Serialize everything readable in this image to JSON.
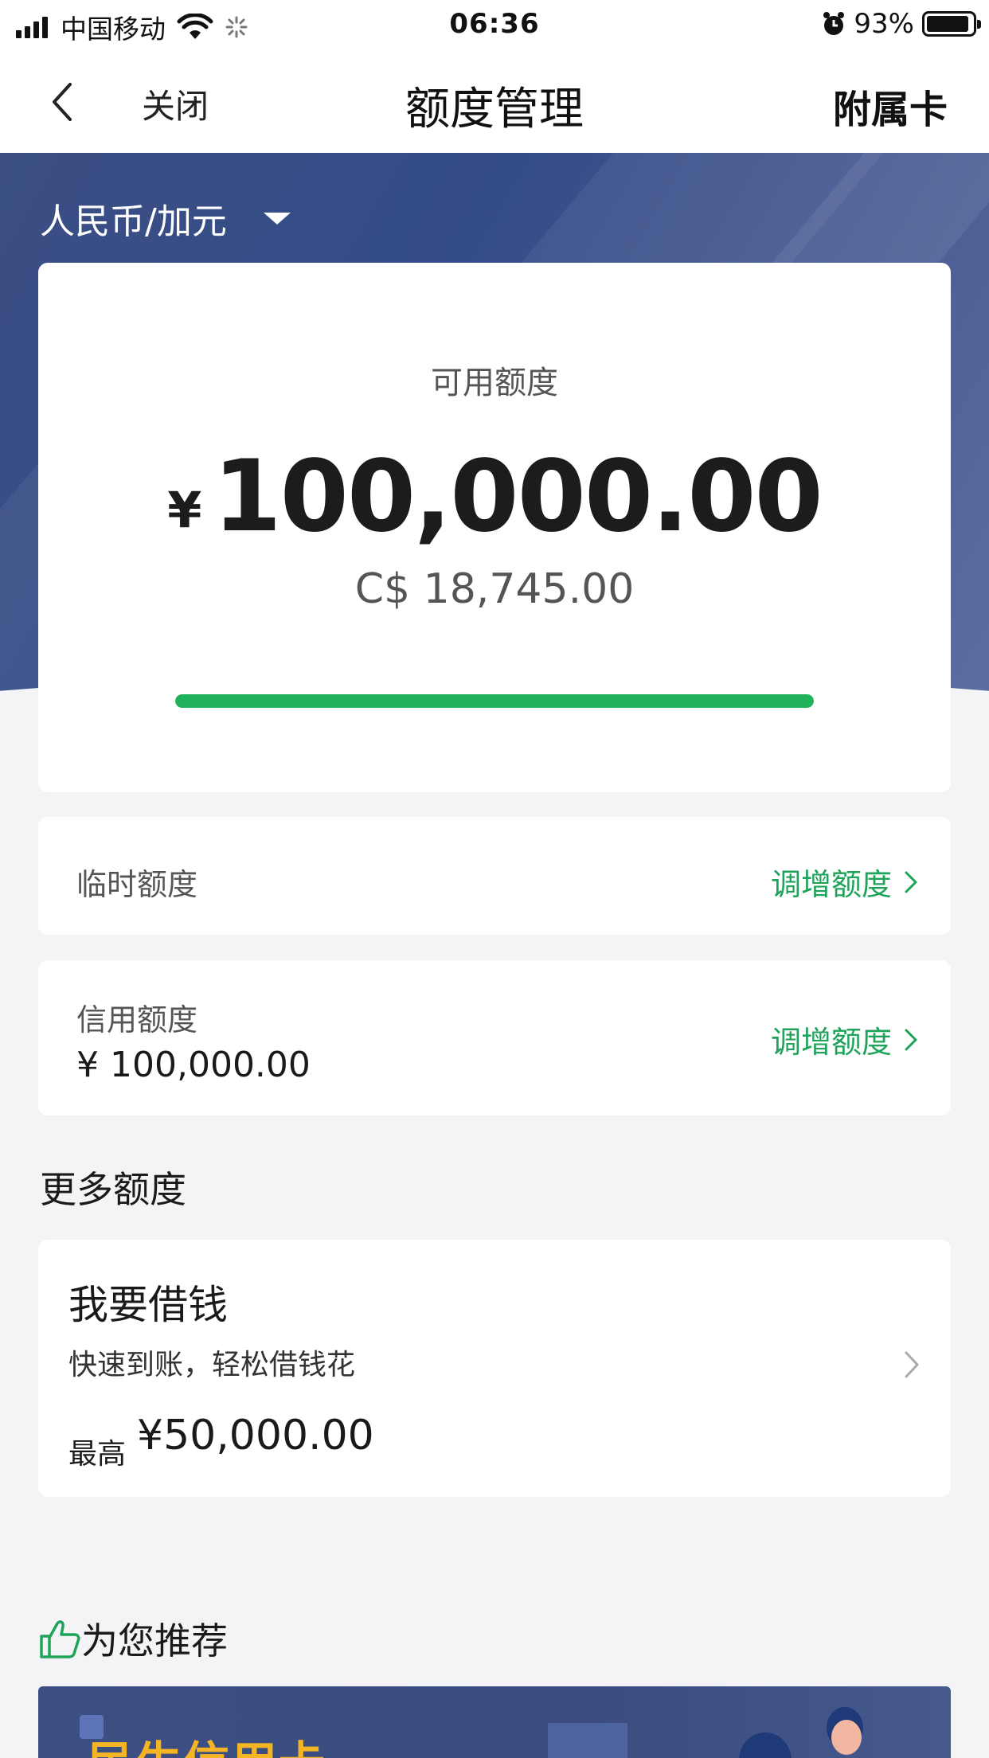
{
  "status_bar": {
    "carrier": "中国移动",
    "time": "06:36",
    "battery_percent": "93%",
    "battery_level": 0.93,
    "icons": [
      "signal-icon",
      "wifi-icon",
      "loading-spinner-icon",
      "alarm-icon",
      "battery-icon"
    ]
  },
  "nav": {
    "close_label": "关闭",
    "title": "额度管理",
    "right_label": "附属卡",
    "back_icon": "chevron-left-icon"
  },
  "currency_selector": {
    "value": "人民币/加元",
    "icon": "caret-down-icon"
  },
  "available": {
    "label": "可用额度",
    "currency_symbol": "¥",
    "amount": "100,000.00",
    "cad_amount": "C$ 18,745.00",
    "usage_ratio": 1.0,
    "bar_color": "#1fb25a"
  },
  "temporary_limit": {
    "label": "临时额度",
    "action_label": "调增额度"
  },
  "credit_limit": {
    "label": "信用额度",
    "value": "¥ 100,000.00",
    "action_label": "调增额度"
  },
  "more_limits": {
    "title": "更多额度",
    "loan": {
      "title": "我要借钱",
      "subtitle": "快速到账，轻松借钱花",
      "max_label": "最高",
      "max_value": "¥50,000.00"
    }
  },
  "recommend": {
    "title": "为您推荐",
    "icon": "thumbs-up-icon",
    "banner_title": "民生信用卡"
  },
  "colors": {
    "accent_green": "#1fa35a",
    "hero_blue": "#334b87",
    "promo_yellow": "#f5b424"
  }
}
